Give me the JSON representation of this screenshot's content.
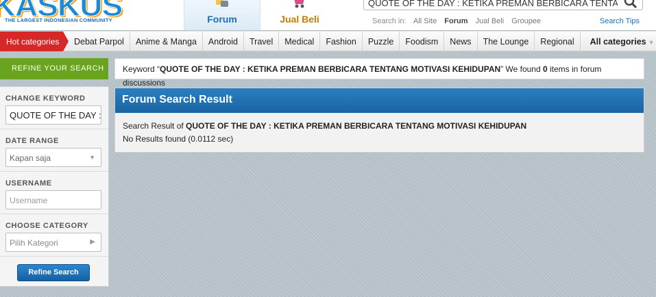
{
  "header": {
    "logo_text": "KASKUS",
    "logo_tagline": "THE LARGEST INDONESIAN COMMUNITY",
    "tabs": [
      {
        "label": "Forum",
        "icon": "forum-icon"
      },
      {
        "label": "Jual Beli",
        "icon": "cart-icon"
      }
    ],
    "search": {
      "value": "QUOTE OF THE DAY : KETIKA PREMAN BERBICARA TENTANG MOTIVASI KEHIDUPAN",
      "search_in_label": "Search in:",
      "scopes": [
        "All Site",
        "Forum",
        "Jual Beli",
        "Groupee"
      ],
      "active_scope": "Forum",
      "tips_label": "Search Tips"
    }
  },
  "catbar": {
    "hot_label": "Hot categories",
    "items": [
      "Debat Parpol",
      "Anime & Manga",
      "Android",
      "Travel",
      "Medical",
      "Fashion",
      "Puzzle",
      "Foodism",
      "News",
      "The Lounge",
      "Regional"
    ],
    "all_label": "All categories"
  },
  "sidebar": {
    "title": "REFINE YOUR SEARCH",
    "keyword_label": "CHANGE KEYWORD",
    "keyword_value": "QUOTE OF THE DAY : KETIKA PREMAN BERBICARA TENTANG MOTIVASI KEHIDUPAN",
    "date_label": "DATE RANGE",
    "date_value": "Kapan saja",
    "username_label": "USERNAME",
    "username_placeholder": "Username",
    "category_label": "CHOOSE CATEGORY",
    "category_value": "Pilih Kategori",
    "refine_button": "Refine Search"
  },
  "main": {
    "keyword_prefix": "Keyword “",
    "keyword": "QUOTE OF THE DAY : KETIKA PREMAN BERBICARA TENTANG MOTIVASI KEHIDUPAN",
    "keyword_mid": "” We found ",
    "count": "0",
    "keyword_suffix": " items in forum",
    "keyword_suffix2": "discussions",
    "panel_title": "Forum Search Result",
    "result_prefix": "Search Result of ",
    "result_query": "QUOTE OF THE DAY : KETIKA PREMAN BERBICARA TENTANG MOTIVASI KEHIDUPAN",
    "no_results": "No Results found (0.0112 sec)"
  },
  "colors": {
    "brand_blue": "#1d8ad6",
    "hot_red": "#d62828",
    "refine_green": "#6aa41e",
    "panel_blue": "#1a64a3"
  }
}
